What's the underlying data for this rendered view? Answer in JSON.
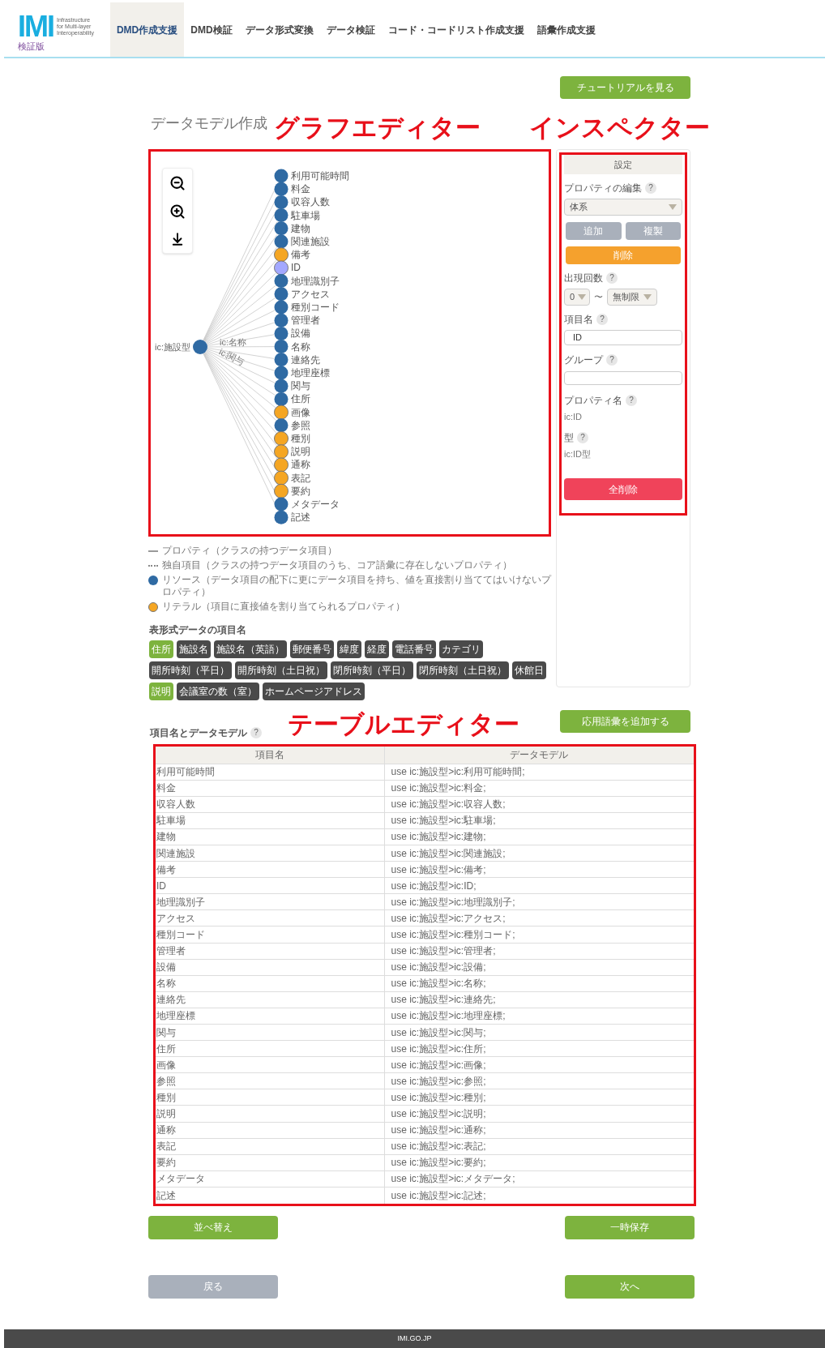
{
  "header": {
    "logo": {
      "mark": "IMI",
      "tagline": [
        "Infrastructure",
        "for Multi-layer",
        "Interoperability"
      ],
      "edition": "検証版"
    },
    "tabs": [
      {
        "label": "DMD作成支援",
        "selected": true
      },
      {
        "label": "DMD検証",
        "selected": false
      },
      {
        "label": "データ形式変換",
        "selected": false
      },
      {
        "label": "データ検証",
        "selected": false
      },
      {
        "label": "コード・コードリスト作成支援",
        "selected": false
      },
      {
        "label": "語彙作成支援",
        "selected": false
      }
    ]
  },
  "tutorial_button": "チュートリアルを見る",
  "page_title": "データモデル作成",
  "annotations": {
    "graph": "グラフエディター",
    "inspector": "インスペクター",
    "table": "テーブルエディター"
  },
  "graph": {
    "root": "ic:施設型",
    "nodes": [
      {
        "name": "利用可能時間",
        "kind": "resource",
        "selected": false
      },
      {
        "name": "料金",
        "kind": "resource",
        "selected": false
      },
      {
        "name": "収容人数",
        "kind": "resource",
        "selected": false
      },
      {
        "name": "駐車場",
        "kind": "resource",
        "selected": false
      },
      {
        "name": "建物",
        "kind": "resource",
        "selected": false
      },
      {
        "name": "関連施設",
        "kind": "resource",
        "selected": false
      },
      {
        "name": "備考",
        "kind": "literal",
        "selected": false
      },
      {
        "name": "ID",
        "kind": "resource",
        "selected": true
      },
      {
        "name": "地理識別子",
        "kind": "resource",
        "selected": false
      },
      {
        "name": "アクセス",
        "kind": "resource",
        "selected": false
      },
      {
        "name": "種別コード",
        "kind": "resource",
        "selected": false
      },
      {
        "name": "管理者",
        "kind": "resource",
        "selected": false
      },
      {
        "name": "設備",
        "kind": "resource",
        "selected": false
      },
      {
        "name": "名称",
        "edge_label": "ic:名称",
        "kind": "resource",
        "selected": false
      },
      {
        "name": "連絡先",
        "kind": "resource",
        "selected": false
      },
      {
        "name": "地理座標",
        "kind": "resource",
        "selected": false
      },
      {
        "name": "関与",
        "edge_label": "ic:関与",
        "kind": "resource",
        "selected": false
      },
      {
        "name": "住所",
        "kind": "resource",
        "selected": false
      },
      {
        "name": "画像",
        "kind": "literal",
        "selected": false
      },
      {
        "name": "参照",
        "kind": "resource",
        "selected": false
      },
      {
        "name": "種別",
        "kind": "literal",
        "selected": false
      },
      {
        "name": "説明",
        "kind": "literal",
        "selected": false
      },
      {
        "name": "通称",
        "kind": "literal",
        "selected": false
      },
      {
        "name": "表記",
        "kind": "literal",
        "selected": false
      },
      {
        "name": "要約",
        "kind": "literal",
        "selected": false
      },
      {
        "name": "メタデータ",
        "kind": "resource",
        "selected": false
      },
      {
        "name": "記述",
        "kind": "resource",
        "selected": false
      }
    ]
  },
  "legend": [
    {
      "kind": "line",
      "text": "プロパティ（クラスの持つデータ項目）"
    },
    {
      "kind": "dotted",
      "text": "独自項目（クラスの持つデータ項目のうち、コア語彙に存在しないプロパティ）"
    },
    {
      "kind": "resource",
      "text": "リソース（データ項目の配下に更にデータ項目を持ち、値を直接割り当ててはいけないプロパティ）"
    },
    {
      "kind": "literal",
      "text": "リテラル（項目に直接値を割り当てられるプロパティ）"
    }
  ],
  "source_columns": {
    "title": "表形式データの項目名",
    "tags": [
      {
        "label": "住所",
        "selected": true
      },
      {
        "label": "施設名",
        "selected": false
      },
      {
        "label": "施設名（英語）",
        "selected": false
      },
      {
        "label": "郵便番号",
        "selected": false
      },
      {
        "label": "緯度",
        "selected": false
      },
      {
        "label": "経度",
        "selected": false
      },
      {
        "label": "電話番号",
        "selected": false
      },
      {
        "label": "カテゴリ",
        "selected": false
      },
      {
        "label": "開所時刻（平日）",
        "selected": false
      },
      {
        "label": "開所時刻（土日祝）",
        "selected": false
      },
      {
        "label": "閉所時刻（平日）",
        "selected": false
      },
      {
        "label": "閉所時刻（土日祝）",
        "selected": false
      },
      {
        "label": "休館日",
        "selected": false
      },
      {
        "label": "説明",
        "selected": true
      },
      {
        "label": "会議室の数（室）",
        "selected": false
      },
      {
        "label": "ホームページアドレス",
        "selected": false
      }
    ]
  },
  "inspector": {
    "title": "設定",
    "property_edit": {
      "label": "プロパティの編集",
      "help": "?",
      "value": "体系"
    },
    "buttons": [
      {
        "label": "追加",
        "kind": "secondary"
      },
      {
        "label": "複製",
        "kind": "secondary"
      },
      {
        "label": "削除",
        "kind": "warning"
      }
    ],
    "occurrence": {
      "label": "出現回数",
      "help": "?",
      "min": "0",
      "separator": "〜",
      "max": "無制限"
    },
    "item_name": {
      "label": "項目名",
      "help": "?",
      "value": "ID"
    },
    "group": {
      "label": "グループ",
      "help": "?"
    },
    "property_name": {
      "label": "プロパティ名",
      "help": "?",
      "value": "ic:ID"
    },
    "type": {
      "label": "型",
      "help": "?",
      "value": "ic:ID型"
    },
    "delete_all": "全削除"
  },
  "add_vocabulary_button": "応用語彙を追加する",
  "table": {
    "title": "項目名とデータモデル",
    "help": "?",
    "columns": [
      "項目名",
      "データモデル"
    ],
    "rows": [
      [
        "利用可能時間",
        "use ic:施設型>ic:利用可能時間;"
      ],
      [
        "料金",
        "use ic:施設型>ic:料金;"
      ],
      [
        "収容人数",
        "use ic:施設型>ic:収容人数;"
      ],
      [
        "駐車場",
        "use ic:施設型>ic:駐車場;"
      ],
      [
        "建物",
        "use ic:施設型>ic:建物;"
      ],
      [
        "関連施設",
        "use ic:施設型>ic:関連施設;"
      ],
      [
        "備考",
        "use ic:施設型>ic:備考;"
      ],
      [
        "ID",
        "use ic:施設型>ic:ID;"
      ],
      [
        "地理識別子",
        "use ic:施設型>ic:地理識別子;"
      ],
      [
        "アクセス",
        "use ic:施設型>ic:アクセス;"
      ],
      [
        "種別コード",
        "use ic:施設型>ic:種別コード;"
      ],
      [
        "管理者",
        "use ic:施設型>ic:管理者;"
      ],
      [
        "設備",
        "use ic:施設型>ic:設備;"
      ],
      [
        "名称",
        "use ic:施設型>ic:名称;"
      ],
      [
        "連絡先",
        "use ic:施設型>ic:連絡先;"
      ],
      [
        "地理座標",
        "use ic:施設型>ic:地理座標;"
      ],
      [
        "関与",
        "use ic:施設型>ic:関与;"
      ],
      [
        "住所",
        "use ic:施設型>ic:住所;"
      ],
      [
        "画像",
        "use ic:施設型>ic:画像;"
      ],
      [
        "参照",
        "use ic:施設型>ic:参照;"
      ],
      [
        "種別",
        "use ic:施設型>ic:種別;"
      ],
      [
        "説明",
        "use ic:施設型>ic:説明;"
      ],
      [
        "通称",
        "use ic:施設型>ic:通称;"
      ],
      [
        "表記",
        "use ic:施設型>ic:表記;"
      ],
      [
        "要約",
        "use ic:施設型>ic:要約;"
      ],
      [
        "メタデータ",
        "use ic:施設型>ic:メタデータ;"
      ],
      [
        "記述",
        "use ic:施設型>ic:記述;"
      ]
    ]
  },
  "actions": [
    {
      "label": "並べ替え",
      "kind": "primary"
    },
    {
      "label": "一時保存",
      "kind": "primary"
    },
    {
      "label": "戻る",
      "kind": "secondary"
    },
    {
      "label": "次へ",
      "kind": "primary"
    }
  ],
  "footer": "IMI.GO.JP"
}
